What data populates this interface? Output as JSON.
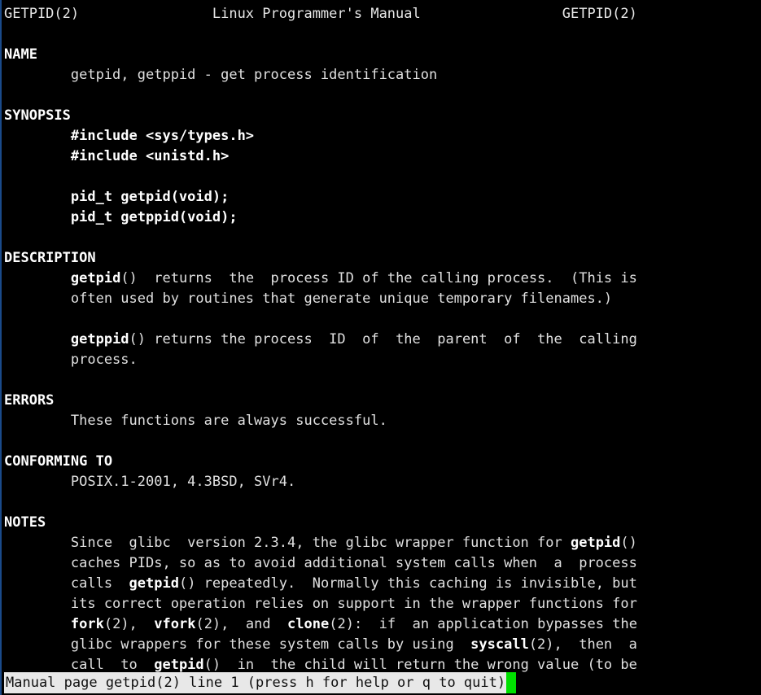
{
  "terminal": {
    "background_color": "#000000",
    "foreground_color": "#e6e6e6",
    "columns": 76,
    "rows": 34
  },
  "man_page": {
    "name": "getpid",
    "section": "2",
    "header": {
      "left": "GETPID(2)",
      "center": "Linux Programmer's Manual",
      "right": "GETPID(2)"
    },
    "sections": [
      {
        "heading": "NAME",
        "lines": [
          [
            {
              "text": "        getpid, getppid - get process identification",
              "bold": false
            }
          ]
        ]
      },
      {
        "heading": "SYNOPSIS",
        "lines": [
          [
            {
              "text": "        #include <sys/types.h>",
              "bold": true
            }
          ],
          [
            {
              "text": "        #include <unistd.h>",
              "bold": true
            }
          ],
          [
            {
              "text": "",
              "bold": false
            }
          ],
          [
            {
              "text": "        pid_t getpid(void);",
              "bold": true
            }
          ],
          [
            {
              "text": "        pid_t getppid(void);",
              "bold": true
            }
          ]
        ]
      },
      {
        "heading": "DESCRIPTION",
        "lines": [
          [
            {
              "text": "        ",
              "bold": false
            },
            {
              "text": "getpid",
              "bold": true
            },
            {
              "text": "()  returns  the  process ID of the calling process.  (This is",
              "bold": false
            }
          ],
          [
            {
              "text": "        often used by routines that generate unique temporary filenames.)",
              "bold": false
            }
          ],
          [
            {
              "text": "",
              "bold": false
            }
          ],
          [
            {
              "text": "        ",
              "bold": false
            },
            {
              "text": "getppid",
              "bold": true
            },
            {
              "text": "() returns the process  ID  of  the  parent  of  the  calling",
              "bold": false
            }
          ],
          [
            {
              "text": "        process.",
              "bold": false
            }
          ]
        ]
      },
      {
        "heading": "ERRORS",
        "lines": [
          [
            {
              "text": "        These functions are always successful.",
              "bold": false
            }
          ]
        ]
      },
      {
        "heading": "CONFORMING TO",
        "lines": [
          [
            {
              "text": "        POSIX.1-2001, 4.3BSD, SVr4.",
              "bold": false
            }
          ]
        ]
      },
      {
        "heading": "NOTES",
        "lines": [
          [
            {
              "text": "        Since  glibc  version 2.3.4, the glibc wrapper function for ",
              "bold": false
            },
            {
              "text": "getpid",
              "bold": true
            },
            {
              "text": "()",
              "bold": false
            }
          ],
          [
            {
              "text": "        caches PIDs, so as to avoid additional system calls when  a  process",
              "bold": false
            }
          ],
          [
            {
              "text": "        calls  ",
              "bold": false
            },
            {
              "text": "getpid",
              "bold": true
            },
            {
              "text": "() repeatedly.  Normally this caching is invisible, but",
              "bold": false
            }
          ],
          [
            {
              "text": "        its correct operation relies on support in the wrapper functions for",
              "bold": false
            }
          ],
          [
            {
              "text": "        ",
              "bold": false
            },
            {
              "text": "fork",
              "bold": true
            },
            {
              "text": "(2),  ",
              "bold": false
            },
            {
              "text": "vfork",
              "bold": true
            },
            {
              "text": "(2),  and  ",
              "bold": false
            },
            {
              "text": "clone",
              "bold": true
            },
            {
              "text": "(2):  if  an application bypasses the",
              "bold": false
            }
          ],
          [
            {
              "text": "        glibc wrappers for these system calls by using  ",
              "bold": false
            },
            {
              "text": "syscall",
              "bold": true
            },
            {
              "text": "(2),  then  a",
              "bold": false
            }
          ],
          [
            {
              "text": "        call  to  ",
              "bold": false
            },
            {
              "text": "getpid",
              "bold": true
            },
            {
              "text": "()  in  the child will return the wrong value (to be",
              "bold": false
            }
          ]
        ]
      }
    ]
  },
  "status_bar": {
    "text": "Manual page getpid(2) line 1 (press h for help or q to quit)",
    "background_color": "#e8e8e8",
    "text_color": "#101010",
    "cursor_color": "#00e000"
  }
}
